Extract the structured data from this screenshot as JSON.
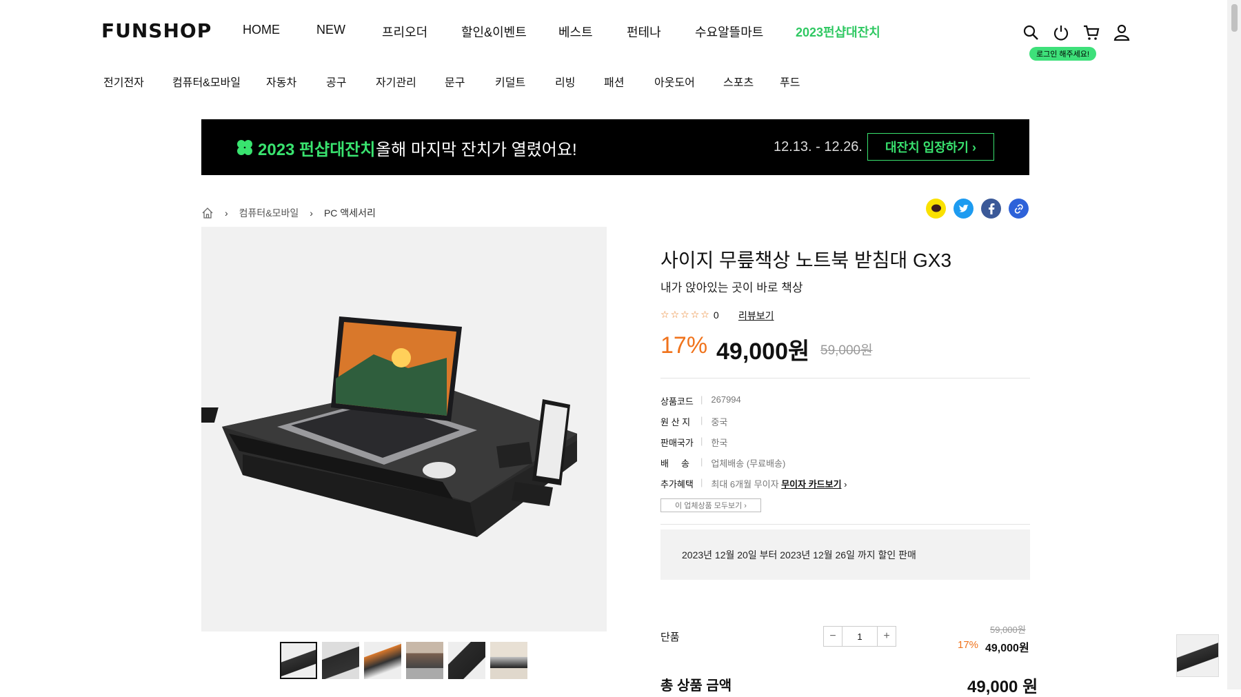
{
  "header": {
    "logo": "FUNSHOP",
    "main_nav": [
      "HOME",
      "NEW",
      "프리오더",
      "할인&이벤트",
      "베스트",
      "펀테나",
      "수요알뜰마트",
      "2023펀샵대잔치"
    ],
    "category_nav": [
      "전기전자",
      "컴퓨터&모바일",
      "자동차",
      "공구",
      "자기관리",
      "문구",
      "키덜트",
      "리빙",
      "패션",
      "아웃도어",
      "스포츠",
      "푸드"
    ],
    "login_badge": "로그인 해주세요!",
    "accent_color": "#39e36f"
  },
  "banner": {
    "title": "2023 펀샵대잔치",
    "subtitle": "올해 마지막 잔치가 열렸어요!",
    "date": "12.13. - 12.26.",
    "button": "대잔치 입장하기 ›"
  },
  "breadcrumb": [
    "컴퓨터&모바일",
    "PC 액세서리"
  ],
  "share_icons": [
    "kakaotalk-icon",
    "twitter-icon",
    "facebook-icon",
    "link-icon"
  ],
  "product": {
    "title": "사이지 무릎책상 노트북 받침대 GX3",
    "subtitle": "내가 앉아있는 곳이 바로 책상",
    "rating_count": "0",
    "review_link": "리뷰보기",
    "discount_rate": "17%",
    "price": "49,000원",
    "original_price": "59,000원",
    "info": [
      {
        "key": "상품코드",
        "value": "267994"
      },
      {
        "key": "원 산 지",
        "value": "중국"
      },
      {
        "key": "판매국가",
        "value": "한국"
      },
      {
        "key": "배     송",
        "value": "업체배송 (무료배송)"
      },
      {
        "key": "추가혜택",
        "value": "최대 6개월 무이자",
        "link": "무이자 카드보기"
      }
    ],
    "vendor_button": "이 업체상품 모두보기 ›",
    "notice": "2023년 12월 20일 부터 2023년 12월 26일 까지 할인 판매",
    "option": {
      "label": "단품",
      "quantity": "1",
      "original_price": "59,000원",
      "rate": "17%",
      "price": "49,000원"
    },
    "total_label": "총 상품 금액",
    "total_price": "49,000 원"
  }
}
